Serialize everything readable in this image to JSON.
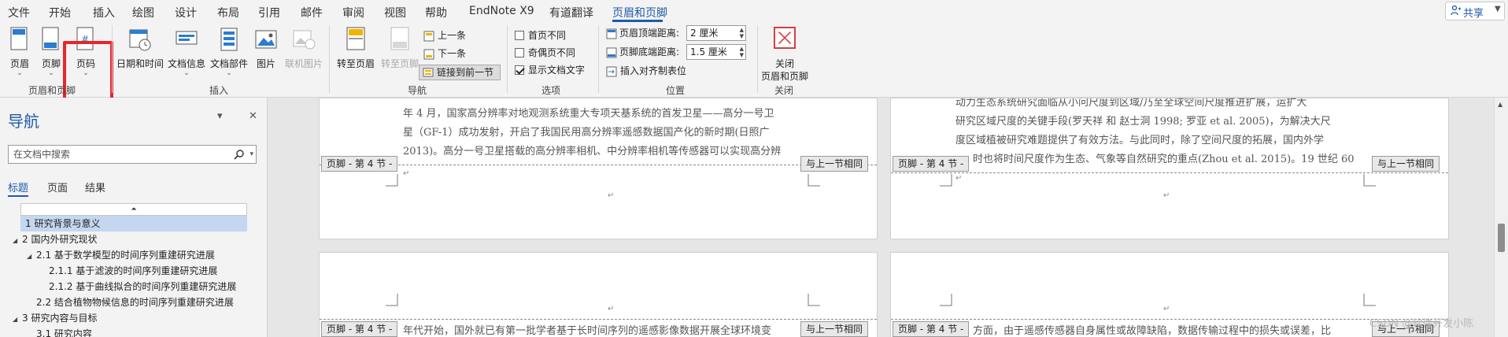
{
  "menu": {
    "tabs": [
      "文件",
      "开始",
      "插入",
      "绘图",
      "设计",
      "布局",
      "引用",
      "邮件",
      "审阅",
      "视图",
      "帮助",
      "EndNote X9",
      "有道翻译",
      "页眉和页脚"
    ],
    "active_tab": "页眉和页脚",
    "share": "共享"
  },
  "ribbon": {
    "group_header_footer": {
      "label": "页眉和页脚",
      "header": "页眉",
      "footer": "页脚",
      "page_number": "页码"
    },
    "group_insert": {
      "label": "插入",
      "date_time": "日期和时间",
      "doc_info": "文档信息",
      "doc_parts": "文档部件",
      "picture": "图片",
      "online_picture": "联机图片"
    },
    "group_nav": {
      "label": "导航",
      "goto_header": "转至页眉",
      "goto_footer": "转至页脚",
      "previous": "上一条",
      "next": "下一条",
      "link_previous": "链接到前一节"
    },
    "group_options": {
      "label": "选项",
      "first_page": "首页不同",
      "odd_even": "奇偶页不同",
      "show_doc_text": "显示文档文字"
    },
    "group_position": {
      "label": "位置",
      "header_top_label": "页眉顶端距离:",
      "header_top_value": "2 厘米",
      "footer_bottom_label": "页脚底端距离:",
      "footer_bottom_value": "1.5 厘米",
      "align_tab": "插入对齐制表位"
    },
    "group_close": {
      "label": "关闭",
      "close_line1": "关闭",
      "close_line2": "页眉和页脚"
    }
  },
  "nav": {
    "title": "导航",
    "search_placeholder": "在文档中搜索",
    "tabs": [
      "标题",
      "页面",
      "结果"
    ],
    "items": [
      "1 研究背景与意义",
      "2 国内外研究现状",
      "2.1 基于数学模型的时间序列重建研究进展",
      "2.1.1 基于滤波的时间序列重建研究进展",
      "2.1.2 基于曲线拟合的时间序列重建研究进展",
      "2.2 结合植物物候信息的时间序列重建研究进展",
      "3 研究内容与目标",
      "3.1 研究内容"
    ]
  },
  "doc": {
    "page1_lines": [
      "年 4 月，国家高分辨率对地观测系统重大专项天基系统的首发卫星——高分一号卫",
      "星（GF-1）成功发射，开启了我国民用高分辨率遥感数据国产化的新时期(日照广",
      "2013)。高分一号卫星搭载的高分辨率相机、中分辨率相机等传感器可以实现高分辨"
    ],
    "page2_lines": [
      "动力生态系统研究面临从小问尺度到区域/乃至全球空间尺度推进扩展，运扩大",
      "研究区域尺度的关键手段(罗天祥  和 赵士洞  1998; 罗亚  et al. 2005)，为解决大尺",
      "度区域植被研究难题提供了有效方法。与此同时，除了空间尺度的拓展，国内外学",
      "时也将时间尺度作为生态、气象等自然研究的重点(Zhou et al. 2015)。19 世纪 60"
    ],
    "page3_line": "年代开始，国外就已有第一批学者基于长时间序列的遥感影像数据开展全球环境变",
    "page4_line": "方面，由于遥感传感器自身属性或故障缺陷，数据传输过程中的损失或误差，比",
    "footer_tag": "页脚 - 第 4 节 -",
    "same_as_prev": "与上一节相同",
    "watermark": "CSDN @软件开发小陈"
  }
}
